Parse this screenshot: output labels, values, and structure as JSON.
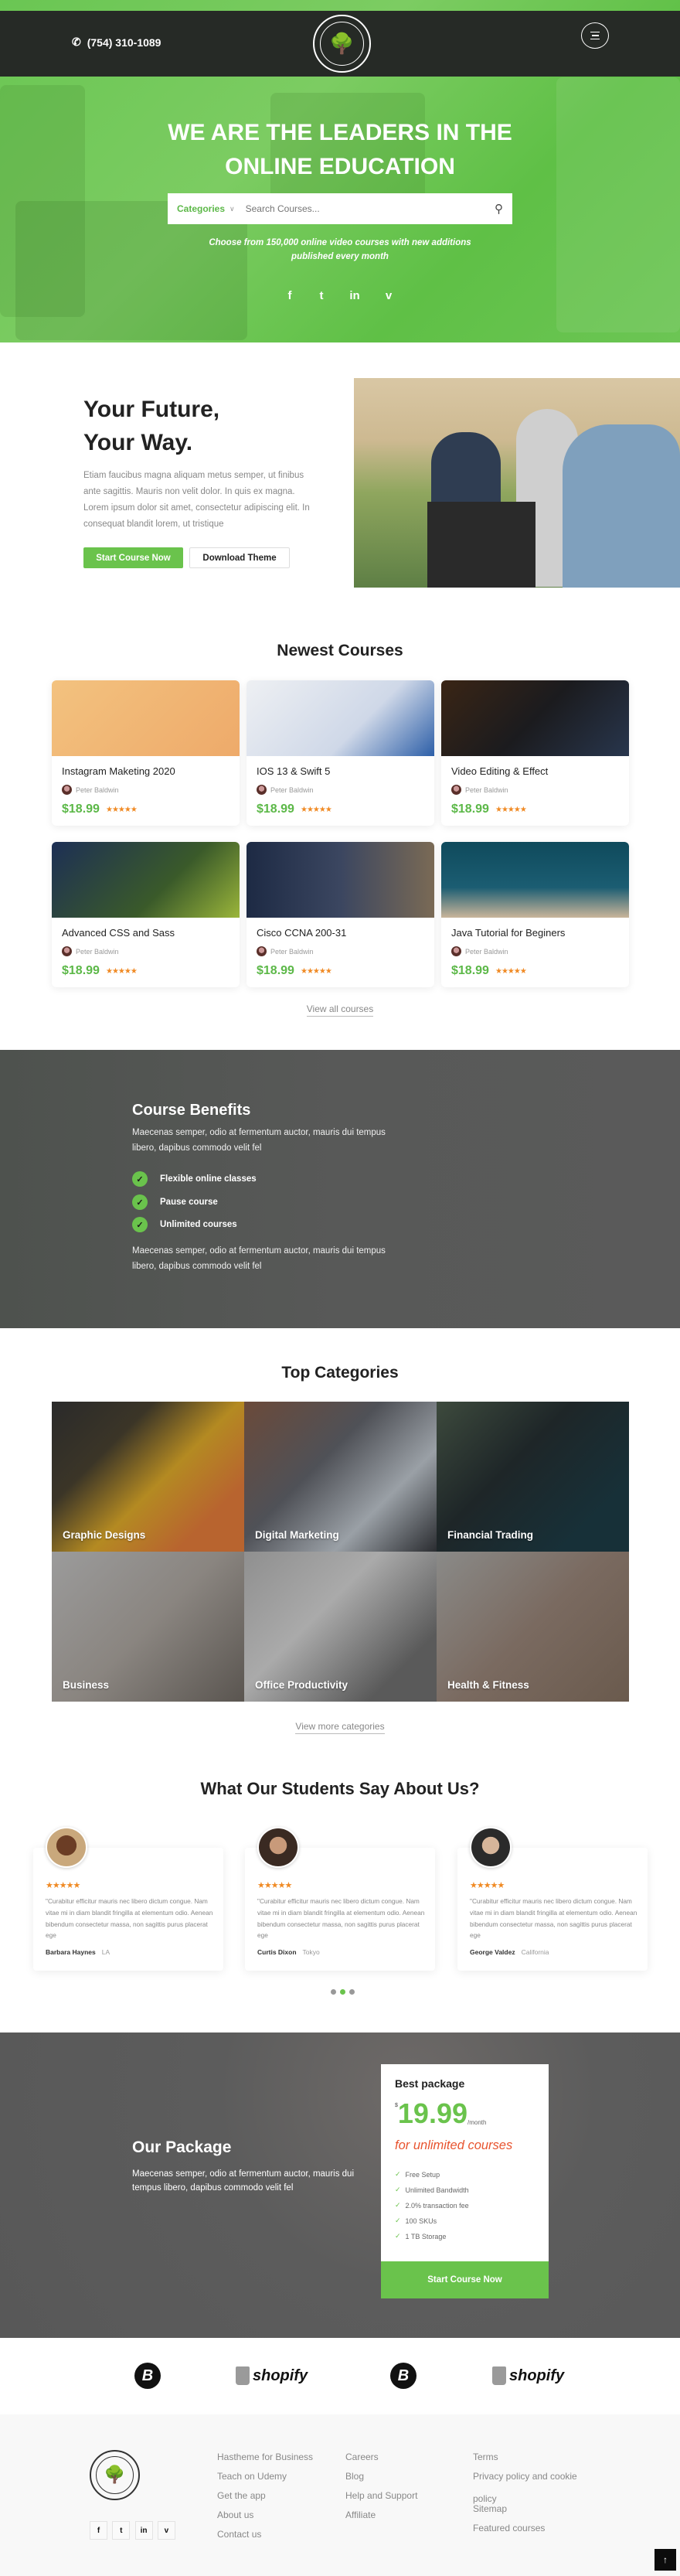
{
  "colors": {
    "accent": "#6ac34c",
    "dark_header": "#262a26",
    "star": "#f08a24",
    "promo_red": "#e8542f"
  },
  "header": {
    "phone": "(754) 310-1089",
    "phone_icon": "phone-icon",
    "logo_text": "COMPANY NAME",
    "logo_tagline": "TAGLINE GOES HERE",
    "menu_icon": "hamburger-icon"
  },
  "hero": {
    "title_line1": "WE ARE THE LEADERS IN THE",
    "title_line2": "ONLINE EDUCATION",
    "search": {
      "category_label": "Categories",
      "placeholder": "Search Courses..."
    },
    "subtitle_line1": "Choose from 150,000 online video courses with new additions",
    "subtitle_line2": "published every month",
    "social": [
      "f",
      "t",
      "in",
      "v"
    ]
  },
  "future": {
    "title_line1": "Your Future,",
    "title_line2": "Your Way.",
    "paragraph": "Etiam faucibus magna aliquam metus semper, ut finibus ante sagittis. Mauris non velit dolor. In quis ex magna. Lorem ipsum dolor sit amet, consectetur adipiscing elit. In consequat blandit lorem, ut tristique",
    "primary_button": "Start Course Now",
    "secondary_button": "Download Theme"
  },
  "courses": {
    "title": "Newest Courses",
    "items": [
      {
        "title": "Instagram Maketing 2020",
        "author": "Peter Baldwin",
        "price": "$18.99",
        "rating": 5
      },
      {
        "title": "IOS 13 & Swift 5",
        "author": "Peter Baldwin",
        "price": "$18.99",
        "rating": 5
      },
      {
        "title": "Video Editing & Effect",
        "author": "Peter Baldwin",
        "price": "$18.99",
        "rating": 5
      },
      {
        "title": "Advanced CSS and Sass",
        "author": "Peter Baldwin",
        "price": "$18.99",
        "rating": 5
      },
      {
        "title": "Cisco CCNA 200-31",
        "author": "Peter Baldwin",
        "price": "$18.99",
        "rating": 5
      },
      {
        "title": "Java Tutorial for Beginers",
        "author": "Peter Baldwin",
        "price": "$18.99",
        "rating": 5
      }
    ],
    "view_all": "View all courses"
  },
  "benefits": {
    "title": "Course Benefits",
    "paragraph1": "Maecenas semper, odio at fermentum auctor, mauris dui tempus libero, dapibus commodo velit fel",
    "items": [
      "Flexible online classes",
      "Pause course",
      "Unlimited courses"
    ],
    "paragraph2": "Maecenas semper, odio at fermentum auctor, mauris dui tempus libero, dapibus commodo velit fel"
  },
  "categories": {
    "title": "Top Categories",
    "items": [
      "Graphic Designs",
      "Digital Marketing",
      "Financial Trading",
      "Business",
      "Office Productivity",
      "Health & Fitness"
    ],
    "view_more": "View more categories"
  },
  "testimonials": {
    "title": "What Our Students Say About Us?",
    "items": [
      {
        "rating": 5,
        "text": "\"Curabitur efficitur mauris nec libero dictum congue. Nam vitae mi in diam blandit fringilla at elementum odio. Aenean bibendum consectetur massa, non sagittis purus placerat ege",
        "name": "Barbara Haynes",
        "city": "LA"
      },
      {
        "rating": 5,
        "text": "\"Curabitur efficitur mauris nec libero dictum congue. Nam vitae mi in diam blandit fringilla at elementum odio. Aenean bibendum consectetur massa, non sagittis purus placerat ege",
        "name": "Curtis Dixon",
        "city": "Tokyo"
      },
      {
        "rating": 5,
        "text": "\"Curabitur efficitur mauris nec libero dictum congue. Nam vitae mi in diam blandit fringilla at elementum odio. Aenean bibendum consectetur massa, non sagittis purus placerat ege",
        "name": "George Valdez",
        "city": "California"
      }
    ],
    "active_page": 2,
    "page_count": 3
  },
  "package": {
    "title": "Our Package",
    "paragraph": "Maecenas semper, odio at fermentum auctor, mauris dui tempus libero, dapibus commodo velit fel",
    "card": {
      "name": "Best package",
      "currency": "$",
      "price": "19.99",
      "period": "/month",
      "tagline": "for unlimited courses",
      "features": [
        "Free Setup",
        "Unlimited Bandwidth",
        "2.0% transaction fee",
        "100 SKUs",
        "1 TB Storage"
      ],
      "button": "Start Course Now"
    }
  },
  "partners": [
    "B",
    "shopify",
    "B",
    "shopify"
  ],
  "footer": {
    "social": [
      "f",
      "t",
      "in",
      "v"
    ],
    "columns": [
      [
        "Hastheme for Business",
        "Teach on Udemy",
        "Get the app",
        "About us",
        "Contact us"
      ],
      [
        "Careers",
        "Blog",
        "Help and Support",
        "Affiliate"
      ],
      [
        "Terms",
        "Privacy policy and cookie policy",
        "Sitemap",
        "Featured courses"
      ]
    ],
    "back_to_top_icon": "arrow-up-icon"
  }
}
